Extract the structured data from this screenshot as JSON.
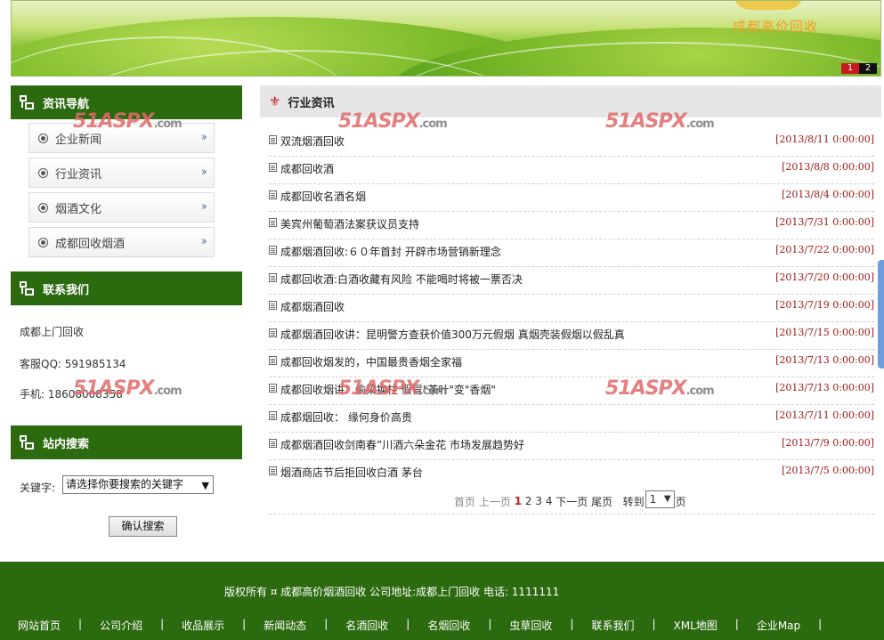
{
  "banner": {
    "brand": "成都高价回收",
    "pager": [
      "1",
      "2"
    ]
  },
  "sidebar": {
    "nav_title": "资讯导航",
    "nav_items": [
      {
        "label": "企业新闻"
      },
      {
        "label": "行业资讯"
      },
      {
        "label": "烟酒文化"
      },
      {
        "label": "成都回收烟酒"
      }
    ],
    "contact_title": "联系我们",
    "contact": {
      "name": "成都上门回收",
      "qq": "客服QQ: 591985134",
      "phone": "手机: 18608008358"
    },
    "search_title": "站内搜索",
    "search": {
      "label": "关键字:",
      "select_value": "请选择你要搜索的关键字",
      "button": "确认搜索"
    }
  },
  "main": {
    "title": "行业资讯",
    "news": [
      {
        "title": "双流烟酒回收",
        "date": "[2013/8/11 0:00:00]"
      },
      {
        "title": "成都回收酒",
        "date": "[2013/8/8 0:00:00]"
      },
      {
        "title": "成都回收名酒名烟",
        "date": "[2013/8/4 0:00:00]"
      },
      {
        "title": "美宾州葡萄酒法案获议员支持",
        "date": "[2013/7/31 0:00:00]"
      },
      {
        "title": "成都烟酒回收:６０年首封 开辟市场营销新理念",
        "date": "[2013/7/22 0:00:00]"
      },
      {
        "title": "成都回收酒:白酒收藏有风险 不能喝时将被一票否决",
        "date": "[2013/7/20 0:00:00]"
      },
      {
        "title": "成都烟酒回收",
        "date": "[2013/7/19 0:00:00]"
      },
      {
        "title": "成都烟酒回收讲：昆明警方查获价值300万元假烟 真烟壳装假烟以假乱真",
        "date": "[2013/7/15 0:00:00]"
      },
      {
        "title": "成都回收烟发的，中国最贵香烟全家福",
        "date": "[2013/7/13 0:00:00]"
      },
      {
        "title": "成都回收烟讲：偷梁换柱 假冒\"茶叶\"变\"香烟\"",
        "date": "[2013/7/13 0:00:00]"
      },
      {
        "title": "成都烟回收： 缘何身价高贵",
        "date": "[2013/7/11 0:00:00]"
      },
      {
        "title": "成都烟酒回收剑南春”川酒六朵金花 市场发展趋势好",
        "date": "[2013/7/9 0:00:00]"
      },
      {
        "title": "烟酒商店节后拒回收白酒 茅台",
        "date": "[2013/7/5 0:00:00]"
      }
    ],
    "pager": {
      "first": "首页",
      "prev": "上一页",
      "pages": [
        "1",
        "2",
        "3",
        "4"
      ],
      "next": "下一页",
      "last": "尾页",
      "goto": "转到",
      "goto_value": "1",
      "page_unit": "页"
    }
  },
  "watermark": {
    "brand": "51ASPX",
    "suffix": ".com"
  },
  "footer": {
    "copyright": "版权所有 ¤ 成都高价烟酒回收 公司地址:成都上门回收 电话: 1111111",
    "links": [
      "网站首页",
      "公司介绍",
      "收品展示",
      "新闻动态",
      "名酒回收",
      "名烟回收",
      "虫草回收",
      "联系我们",
      "XML地图",
      "企业Map"
    ]
  },
  "colors": {
    "green": "#2c6a10",
    "date_red": "#a01818",
    "accent_red": "#c8191d"
  }
}
